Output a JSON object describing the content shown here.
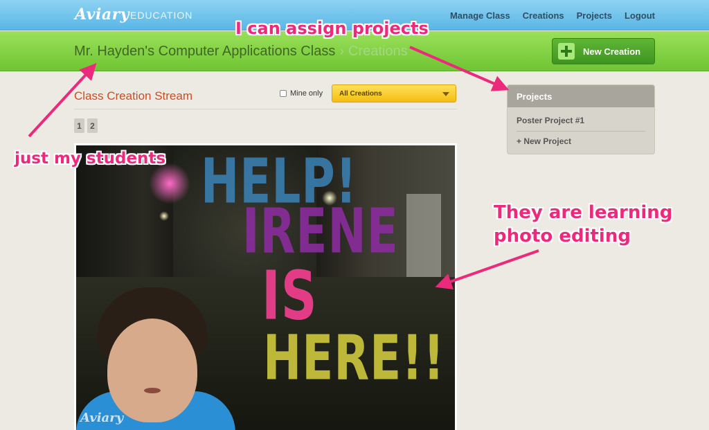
{
  "topnav": {
    "logo": "Aviary",
    "logo_sub": "EDUCATION",
    "links": [
      "Manage Class",
      "Creations",
      "Projects",
      "Logout"
    ]
  },
  "header": {
    "class_name": "Mr. Hayden's Computer Applications Class",
    "separator": "›",
    "current": "Creations",
    "new_button": "New Creation"
  },
  "stream": {
    "title": "Class Creation Stream",
    "mine_only_label": "Mine only",
    "filter_value": "All Creations",
    "pages": [
      "1",
      "2"
    ]
  },
  "creation": {
    "poster_lines": [
      "HELP!",
      "IRENE",
      "IS",
      "HERE!!"
    ],
    "watermark": "Aviary"
  },
  "projects": {
    "title": "Projects",
    "items": [
      "Poster Project #1"
    ],
    "new_link": "+ New Project"
  },
  "annotations": {
    "assign": "I can assign projects",
    "students": "just my students",
    "learning_1": "They are learning",
    "learning_2": "photo editing"
  },
  "colors": {
    "topbar": "#59b6e6",
    "greenbar": "#6fc533",
    "accent_orange": "#d24a1f",
    "annotation_pink": "#ec2a7c",
    "select_yellow": "#f4be12"
  }
}
